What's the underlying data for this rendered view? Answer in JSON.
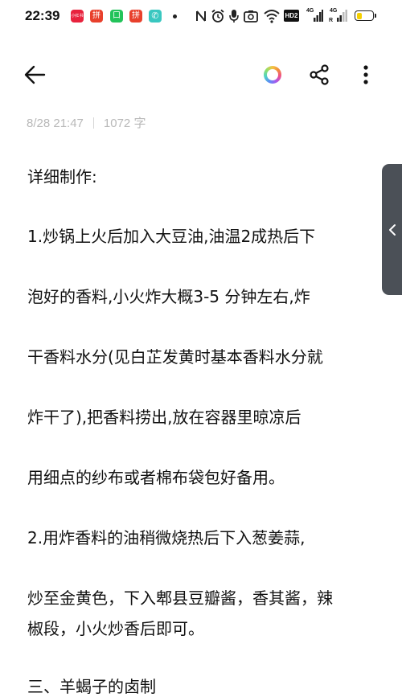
{
  "status_bar": {
    "time": "22:39",
    "hd_label": "HD2",
    "network_1": "4G",
    "network_2": "4G",
    "app_icons": [
      {
        "name": "xiaohongshu-icon",
        "color": "#e8223d",
        "label": "小红书"
      },
      {
        "name": "pinduoduo-icon",
        "color": "#e8402c",
        "label": "拼"
      },
      {
        "name": "wechat-style-icon",
        "color": "#22c35a",
        "label": "口"
      },
      {
        "name": "pinduoduo-icon-2",
        "color": "#e8402c",
        "label": "拼"
      },
      {
        "name": "phone-icon",
        "color": "#39c7c0",
        "label": "✆"
      }
    ],
    "battery_level": 0.28
  },
  "toolbar": {
    "back_icon": "arrow-left-icon",
    "color_icon": "color-palette-icon",
    "share_icon": "share-icon",
    "more_icon": "more-vertical-icon"
  },
  "note": {
    "date": "8/28 21:47",
    "word_count": "1072 字",
    "lines": [
      "详细制作:",
      "1.炒锅上火后加入大豆油,油温2成热后下",
      "泡好的香料,小火炸大概3-5 分钟左右,炸",
      "干香料水分(见白芷发黄时基本香料水分就",
      "炸干了),把香料捞出,放在容器里晾凉后",
      "用细点的纱布或者棉布袋包好备用。",
      "2.用炸香料的油稍微烧热后下入葱姜蒜,",
      "炒至金黄色，下入郫县豆瓣酱，香其酱，辣",
      "椒段，小火炒香后即可。",
      "三、羊蝎子的卤制"
    ]
  },
  "side_handle": {
    "icon": "chevron-left-icon"
  }
}
